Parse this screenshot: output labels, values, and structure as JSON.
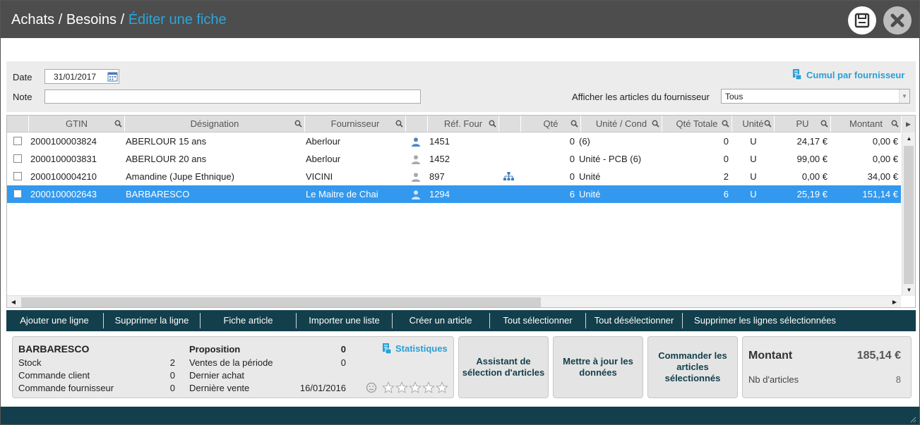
{
  "header": {
    "crumb_1": "Achats",
    "crumb_sep": "/",
    "crumb_2": "Besoins",
    "crumb_3": "Éditer une fiche",
    "save_icon": "save-icon",
    "close_icon": "close-icon"
  },
  "filters": {
    "date_label": "Date",
    "date_value": "31/01/2017",
    "note_label": "Note",
    "note_value": "",
    "cumul_link": "Cumul par fournisseur",
    "supplier_filter_label": "Afficher les articles du fournisseur",
    "supplier_filter_value": "Tous"
  },
  "grid": {
    "columns": {
      "gtin": "GTIN",
      "designation": "Désignation",
      "fournisseur": "Fournisseur",
      "ref_four": "Réf. Four",
      "qte": "Qté",
      "unite_cond": "Unité / Cond",
      "qte_totale": "Qté Totale",
      "unite": "Unité",
      "pu": "PU",
      "montant": "Montant"
    },
    "rows": [
      {
        "gtin": "2000100003824",
        "designation": "ABERLOUR 15 ans",
        "fournisseur": "Aberlour",
        "ref_four": "1451",
        "qte": "0",
        "unite_cond": "(6)",
        "qte_totale": "0",
        "unite": "U",
        "pu": "24,17 €",
        "montant": "0,00 €",
        "supplier_icon": "user-icon-blue",
        "variant_icon": ""
      },
      {
        "gtin": "2000100003831",
        "designation": "ABERLOUR 20 ans",
        "fournisseur": "Aberlour",
        "ref_four": "1452",
        "qte": "0",
        "unite_cond": "Unité - PCB (6)",
        "qte_totale": "0",
        "unite": "U",
        "pu": "99,00 €",
        "montant": "0,00 €",
        "supplier_icon": "user-icon-grey",
        "variant_icon": ""
      },
      {
        "gtin": "2000100004210",
        "designation": "Amandine (Jupe Ethnique)",
        "fournisseur": "VICINI",
        "ref_four": "897",
        "qte": "0",
        "unite_cond": "Unité",
        "qte_totale": "2",
        "unite": "U",
        "pu": "0,00 €",
        "montant": "34,00 €",
        "supplier_icon": "user-icon-grey",
        "variant_icon": "hierarchy-icon"
      },
      {
        "gtin": "2000100002643",
        "designation": "BARBARESCO",
        "fournisseur": "Le Maitre de Chai",
        "ref_four": "1294",
        "qte": "6",
        "unite_cond": "Unité",
        "qte_totale": "6",
        "unite": "U",
        "pu": "25,19 €",
        "montant": "151,14 €",
        "supplier_icon": "user-icon-grey",
        "variant_icon": "",
        "selected": true
      }
    ]
  },
  "toolbar": {
    "add_line": "Ajouter une ligne",
    "delete_line": "Supprimer la ligne",
    "item_sheet": "Fiche article",
    "import_list": "Importer une liste",
    "create_item": "Créer un article",
    "select_all": "Tout sélectionner",
    "deselect_all": "Tout désélectionner",
    "delete_selected": "Supprimer les lignes sélectionnées"
  },
  "info": {
    "item_name": "BARBARESCO",
    "stock_label": "Stock",
    "stock_value": "2",
    "cmd_client_label": "Commande client",
    "cmd_client_value": "0",
    "cmd_four_label": "Commande fournisseur",
    "cmd_four_value": "0",
    "proposition_label": "Proposition",
    "proposition_value": "0",
    "ventes_label": "Ventes de la période",
    "ventes_value": "0",
    "dernier_achat_label": "Dernier achat",
    "dernier_achat_value": "",
    "derniere_vente_label": "Dernière vente",
    "derniere_vente_value": "16/01/2016",
    "stats_link": "Statistiques",
    "rating": 0,
    "rating_max": 5
  },
  "actions": {
    "assistant_line1": "Assistant de",
    "assistant_line2": "sélection d'articles",
    "update_line1": "Mettre à jour les",
    "update_line2": "données",
    "order_line1": "Commander les",
    "order_line2": "articles",
    "order_line3": "sélectionnés"
  },
  "summary": {
    "montant_label": "Montant",
    "montant_value": "185,14 €",
    "nb_label": "Nb d'articles",
    "nb_value": "8"
  },
  "colors": {
    "title_bg": "#4d4d4d",
    "accent": "#2aa6dc",
    "toolbar_bg": "#123f4b",
    "selected_row": "#3399ee"
  }
}
